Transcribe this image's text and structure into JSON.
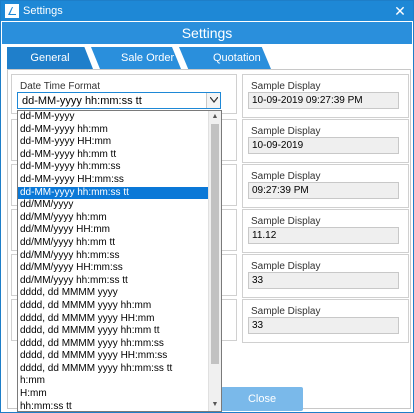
{
  "window": {
    "title": "Settings",
    "close_glyph": "✕"
  },
  "header": {
    "title": "Settings"
  },
  "tabs": [
    {
      "label": "General"
    },
    {
      "label": "Sale Order"
    },
    {
      "label": "Quotation"
    }
  ],
  "date_format": {
    "label": "Date Time Format",
    "selected_value": "dd-MM-yyyy hh:mm:ss tt",
    "options": [
      "dd-MM-yyyy",
      "dd-MM-yyyy hh:mm",
      "dd-MM-yyyy HH:mm",
      "dd-MM-yyyy hh:mm tt",
      "dd-MM-yyyy hh:mm:ss",
      "dd-MM-yyyy HH:mm:ss",
      "dd-MM-yyyy hh:mm:ss tt",
      "dd/MM/yyyy",
      "dd/MM/yyyy hh:mm",
      "dd/MM/yyyy HH:mm",
      "dd/MM/yyyy hh:mm tt",
      "dd/MM/yyyy hh:mm:ss",
      "dd/MM/yyyy HH:mm:ss",
      "dd/MM/yyyy hh:mm:ss tt",
      "dddd, dd MMMM yyyy",
      "dddd, dd MMMM yyyy hh:mm",
      "dddd, dd MMMM yyyy HH:mm",
      "dddd, dd MMMM yyyy hh:mm tt",
      "dddd, dd MMMM yyyy hh:mm:ss",
      "dddd, dd MMMM yyyy HH:mm:ss",
      "dddd, dd MMMM yyyy hh:mm:ss tt",
      "h:mm",
      "H:mm",
      "hh:mm:ss tt"
    ],
    "selected_index": 6
  },
  "samples": [
    {
      "title": "Sample Display",
      "value": "10-09-2019 09:27:39 PM"
    },
    {
      "title": "Sample Display",
      "value": "10-09-2019"
    },
    {
      "title": "Sample Display",
      "value": "09:27:39 PM"
    },
    {
      "title": "Sample Display",
      "value": "11.12"
    },
    {
      "title": "Sample Display",
      "value": "33"
    },
    {
      "title": "Sample Display",
      "value": "33"
    }
  ],
  "footer": {
    "close_label": "Close"
  },
  "icons": {
    "app": "app-logo-icon",
    "dropdown": "chevron-down-icon",
    "scroll_up": "scroll-up-icon",
    "scroll_down": "scroll-down-icon"
  },
  "colors": {
    "accent": "#1e88d6",
    "selection": "#0a78d7",
    "close_button": "#7ab9ea"
  }
}
